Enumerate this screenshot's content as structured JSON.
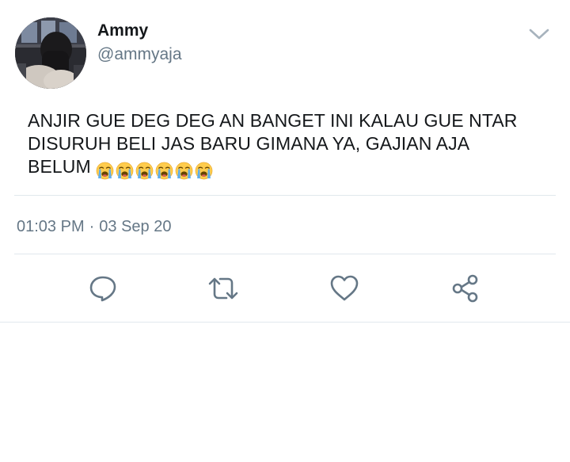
{
  "author": {
    "display_name": "Ammy",
    "handle": "@ammyaja"
  },
  "tweet": {
    "text": "ANJIR GUE DEG DEG AN BANGET INI KALAU GUE NTAR DISURUH BELI JAS BARU GIMANA YA, GAJIAN AJA BELUM",
    "emojis": [
      "loudly-crying-face",
      "loudly-crying-face",
      "loudly-crying-face",
      "loudly-crying-face",
      "loudly-crying-face",
      "loudly-crying-face"
    ]
  },
  "meta": {
    "time": "01:03 PM",
    "separator": "·",
    "date": "03 Sep 20"
  },
  "actions": {
    "icons": [
      "reply-icon",
      "retweet-icon",
      "like-icon",
      "share-icon"
    ]
  },
  "colors": {
    "text": "#14171a",
    "secondary": "#657786",
    "divider": "#e1e8ed",
    "icon": "#657786"
  }
}
